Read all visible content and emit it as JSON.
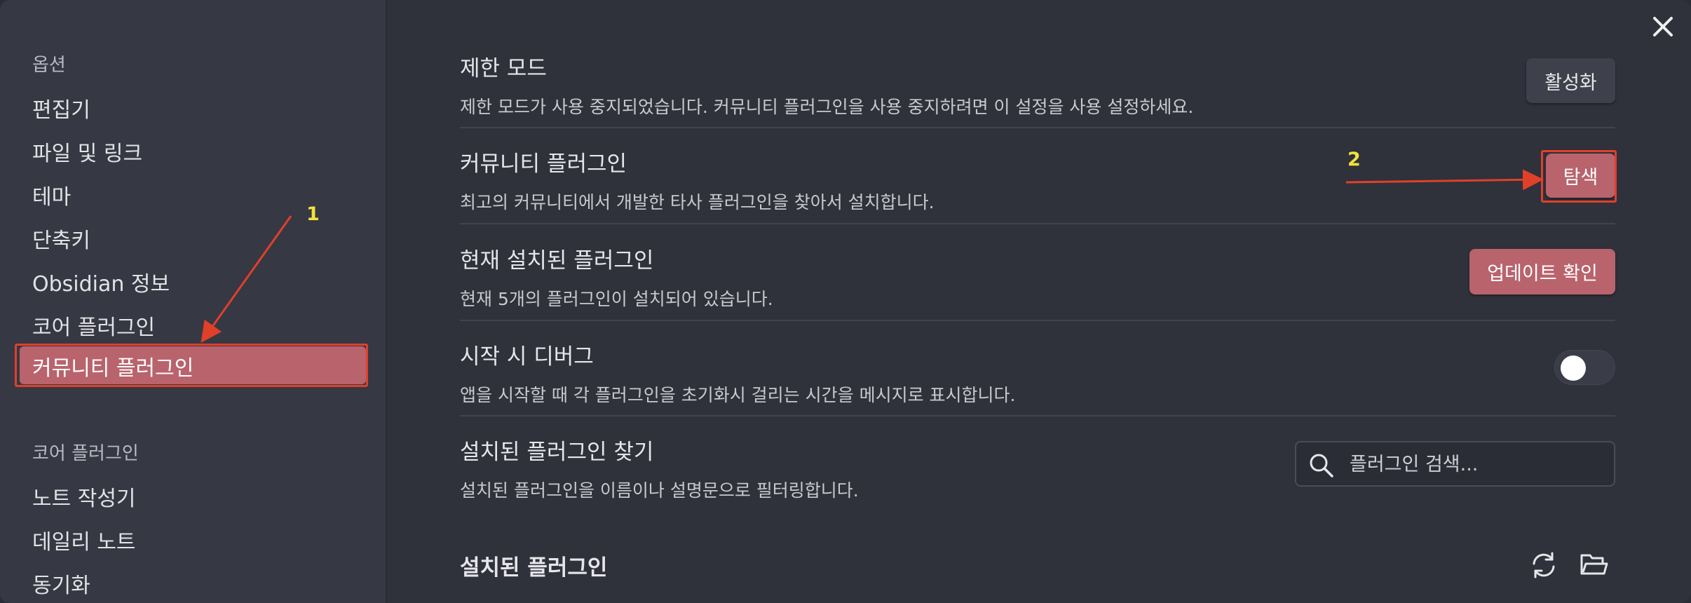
{
  "sidebar": {
    "options_heading": "옵션",
    "options_items": [
      {
        "label": "편집기"
      },
      {
        "label": "파일 및 링크"
      },
      {
        "label": "테마"
      },
      {
        "label": "단축키"
      },
      {
        "label": "Obsidian 정보"
      },
      {
        "label": "코어 플러그인"
      }
    ],
    "active_item": "커뮤니티 플러그인",
    "core_heading": "코어 플러그인",
    "core_items": [
      {
        "label": "노트 작성기"
      },
      {
        "label": "데일리 노트"
      },
      {
        "label": "동기화"
      }
    ]
  },
  "settings": {
    "restricted_mode": {
      "title": "제한 모드",
      "description": "제한 모드가 사용 중지되었습니다. 커뮤니티 플러그인을 사용 중지하려면 이 설정을 사용 설정하세요.",
      "button": "활성화"
    },
    "community_plugins": {
      "title": "커뮤니티 플러그인",
      "description": "최고의 커뮤니티에서 개발한 타사 플러그인을 찾아서 설치합니다.",
      "button": "탐색"
    },
    "installed_plugins_now": {
      "title": "현재 설치된 플러그인",
      "description": "현재 5개의 플러그인이 설치되어 있습니다.",
      "button": "업데이트 확인"
    },
    "debug_startup": {
      "title": "시작 시 디버그",
      "description": "앱을 시작할 때 각 플러그인을 초기화시 걸리는 시간을 메시지로 표시합니다.",
      "toggle_on": false
    },
    "find_installed": {
      "title": "설치된 플러그인 찾기",
      "description": "설치된 플러그인을 이름이나 설명문으로 필터링합니다.",
      "search_placeholder": "플러그인 검색..."
    }
  },
  "installed_section": {
    "title": "설치된 플러그인"
  },
  "annotations": {
    "label1": "1",
    "label2": "2",
    "color": "#e0402a",
    "number_color": "#f2e23a"
  },
  "icons": {
    "close": "close-icon",
    "search": "search-icon",
    "reload": "reload-icon",
    "folder": "folder-icon"
  },
  "colors": {
    "accent": "#b9636d",
    "sidebar_bg": "#363843",
    "main_bg": "#2f313b"
  }
}
